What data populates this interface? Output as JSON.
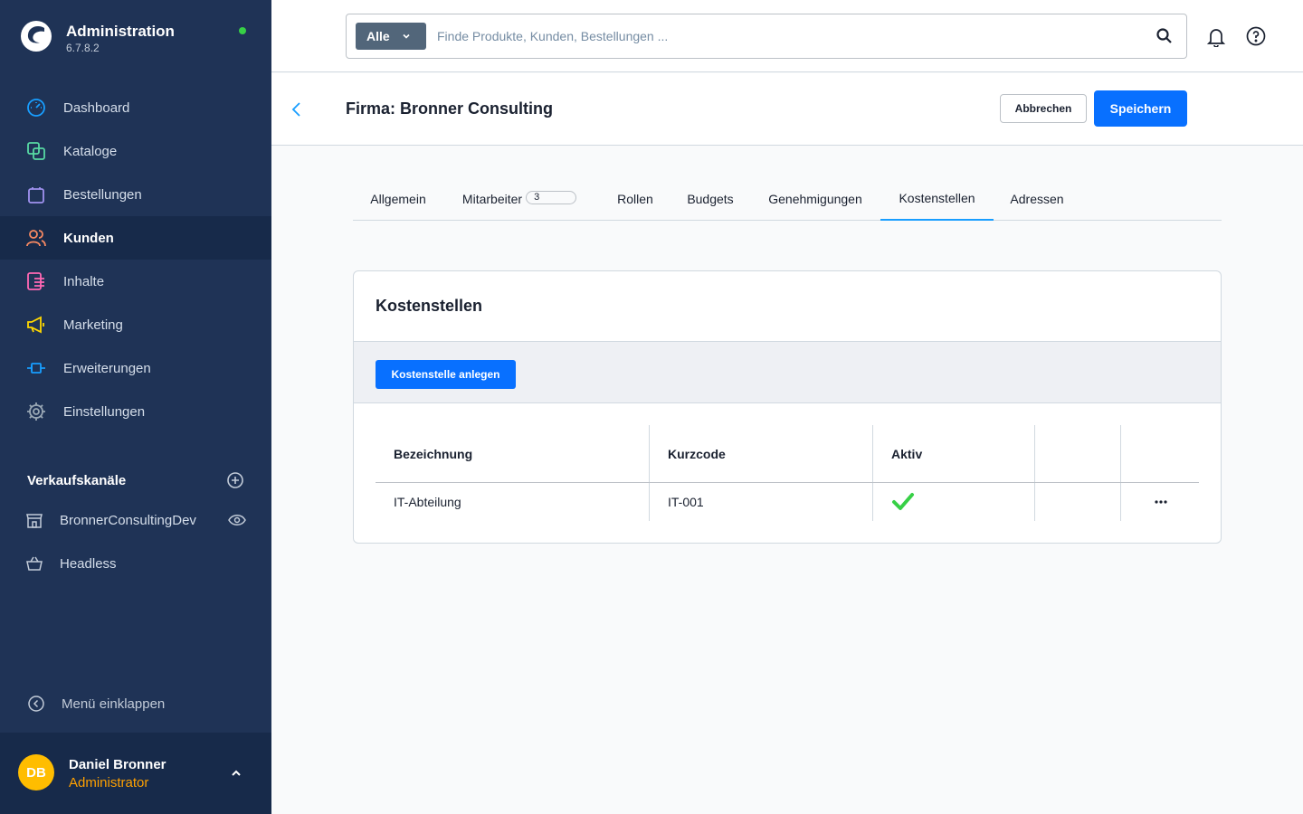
{
  "app": {
    "title": "Administration",
    "version": "6.7.8.2",
    "status_color": "#37d046"
  },
  "sidebar": {
    "items": [
      {
        "label": "Dashboard",
        "icon": "gauge-icon",
        "color": "#189eff"
      },
      {
        "label": "Kataloge",
        "icon": "catalog-icon",
        "color": "#57d9a3"
      },
      {
        "label": "Bestellungen",
        "icon": "shopping-bag-icon",
        "color": "#a092f0"
      },
      {
        "label": "Kunden",
        "icon": "users-icon",
        "color": "#f88962",
        "active": true
      },
      {
        "label": "Inhalte",
        "icon": "content-icon",
        "color": "#ff68b4"
      },
      {
        "label": "Marketing",
        "icon": "megaphone-icon",
        "color": "#ffd700"
      },
      {
        "label": "Erweiterungen",
        "icon": "plug-icon",
        "color": "#189eff"
      },
      {
        "label": "Einstellungen",
        "icon": "gear-icon",
        "color": "#9aa8b5"
      }
    ],
    "channels_title": "Verkaufskanäle",
    "channels": [
      {
        "label": "BronnerConsultingDev",
        "icon": "storefront-icon"
      },
      {
        "label": "Headless",
        "icon": "basket-icon"
      }
    ],
    "collapse_label": "Menü einklappen",
    "user": {
      "initials": "DB",
      "name": "Daniel Bronner",
      "role": "Administrator",
      "avatar_color": "#ffbd00"
    }
  },
  "search": {
    "type_label": "Alle",
    "placeholder": "Finde Produkte, Kunden, Bestellungen ..."
  },
  "smartbar": {
    "title": "Firma: Bronner Consulting",
    "cancel_label": "Abbrechen",
    "save_label": "Speichern"
  },
  "tabs": [
    {
      "label": "Allgemein"
    },
    {
      "label": "Mitarbeiter",
      "badge": "3"
    },
    {
      "label": "Rollen"
    },
    {
      "label": "Budgets"
    },
    {
      "label": "Genehmigungen"
    },
    {
      "label": "Kostenstellen",
      "active": true
    },
    {
      "label": "Adressen"
    }
  ],
  "card": {
    "title": "Kostenstellen",
    "create_label": "Kostenstelle anlegen",
    "columns": [
      "Bezeichnung",
      "Kurzcode",
      "Aktiv"
    ],
    "rows": [
      {
        "name": "IT-Abteilung",
        "code": "IT-001",
        "active": true
      }
    ]
  },
  "colors": {
    "primary": "#0870ff",
    "sidebar_bg": "#1f3356",
    "check": "#37d046"
  }
}
